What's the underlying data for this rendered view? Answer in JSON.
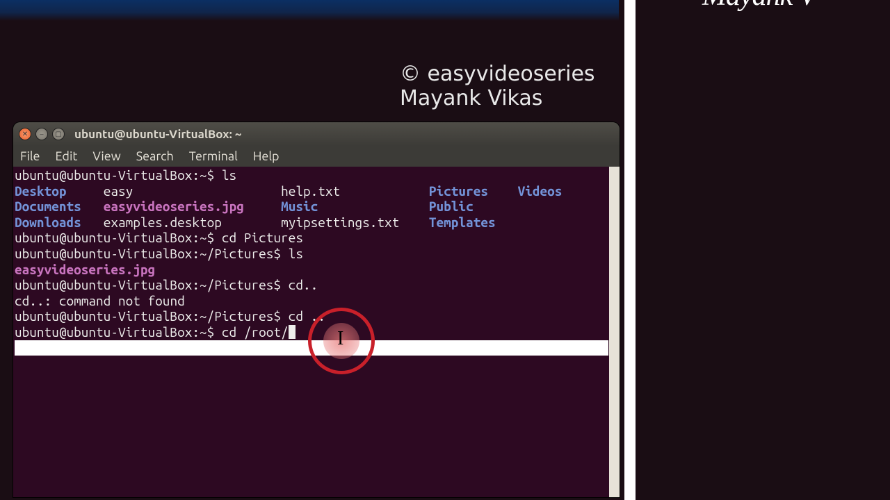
{
  "page": {
    "credit_line1": "© easyvideoseries",
    "credit_line2": "Mayank Vikas",
    "right_partial": "Mayank V"
  },
  "window": {
    "title": "ubuntu@ubuntu-VirtualBox: ~",
    "menu": {
      "file": "File",
      "edit": "Edit",
      "view": "View",
      "search": "Search",
      "terminal": "Terminal",
      "help": "Help"
    }
  },
  "term": {
    "prompt_home": "ubuntu@ubuntu-VirtualBox:~$ ",
    "prompt_pics": "ubuntu@ubuntu-VirtualBox:~/Pictures$ ",
    "cmd_ls": "ls",
    "cmd_cd_pictures": "cd Pictures",
    "cmd_cd_nospace": "cd..",
    "err_cd": "cd..: command not found",
    "cmd_cd_space": "cd ..",
    "cmd_cd_root": "cd /root/",
    "ls_row1": {
      "c1": "Desktop",
      "c2": "easy",
      "c3": "help.txt",
      "c4": "Pictures",
      "c5": "Videos"
    },
    "ls_row2": {
      "c1": "Documents",
      "c2": "easyvideoseries.jpg",
      "c3": "Music",
      "c4": "Public",
      "c5": ""
    },
    "ls_row3": {
      "c1": "Downloads",
      "c2": "examples.desktop",
      "c3": "myipsettings.txt",
      "c4": "Templates",
      "c5": ""
    },
    "pics_file": "easyvideoseries.jpg"
  },
  "cols": {
    "c1": 12,
    "c2": 24,
    "c3": 20,
    "c4": 12,
    "c5": 8
  }
}
